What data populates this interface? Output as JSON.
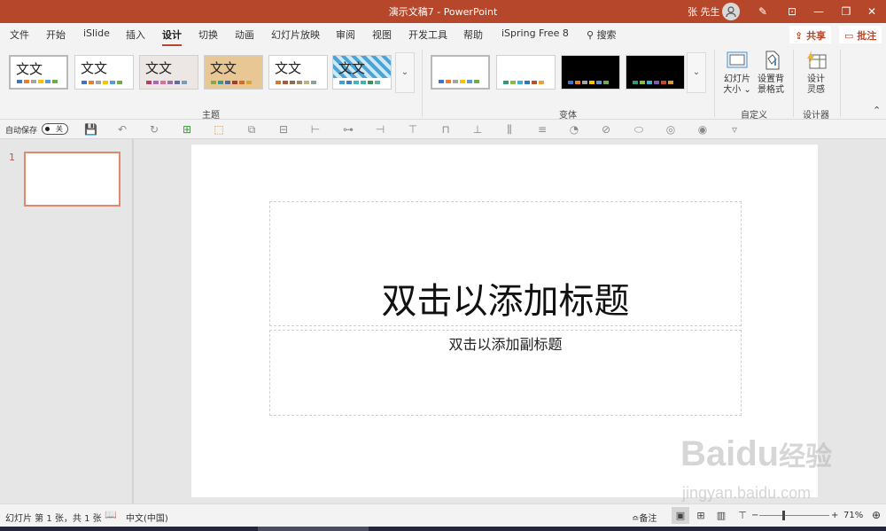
{
  "title_bar": {
    "document_title": "演示文稿7 - PowerPoint",
    "user_name": "张 先生",
    "icons": [
      "avatar-icon",
      "pen-icon",
      "ribbon-display-icon",
      "minimize-icon",
      "restore-icon",
      "close-icon"
    ],
    "glyphs": {
      "pen": "✎",
      "ribbon_display": "⊡",
      "minimize": "—",
      "restore": "❐",
      "close": "✕"
    }
  },
  "menu": {
    "tabs": [
      {
        "label": "文件"
      },
      {
        "label": "开始"
      },
      {
        "label": "iSlide"
      },
      {
        "label": "插入"
      },
      {
        "label": "设计",
        "active": true
      },
      {
        "label": "切换"
      },
      {
        "label": "动画"
      },
      {
        "label": "幻灯片放映"
      },
      {
        "label": "审阅"
      },
      {
        "label": "视图"
      },
      {
        "label": "开发工具"
      },
      {
        "label": "帮助"
      },
      {
        "label": "iSpring Free 8"
      }
    ],
    "search_label": "搜索",
    "search_glyph": "⚲",
    "share_label": "共享",
    "share_glyph": "⇪",
    "comment_label": "批注",
    "comment_glyph": "▭"
  },
  "ribbon": {
    "themes_group_label": "主题",
    "themes": [
      {
        "name": "office-theme",
        "text": "文文",
        "bg": "#ffffff",
        "swatches": [
          "#4472c4",
          "#ed7d31",
          "#a5a5a5",
          "#ffc000",
          "#5b9bd5",
          "#70ad47"
        ]
      },
      {
        "name": "office-theme-2",
        "text": "文文",
        "bg": "#ffffff",
        "swatches": [
          "#4472c4",
          "#ed7d31",
          "#a5a5a5",
          "#ffc000",
          "#5b9bd5",
          "#70ad47"
        ]
      },
      {
        "name": "theme-3",
        "text": "文文",
        "bg": "#ece7e4",
        "swatches": [
          "#b83d68",
          "#ac66bb",
          "#de6c9f",
          "#9d6fa6",
          "#5f6ca8",
          "#7b9bb7"
        ]
      },
      {
        "name": "theme-4",
        "text": "文文",
        "bg": "#e8c795",
        "swatches": [
          "#8da54b",
          "#3a9a8e",
          "#4c6aa6",
          "#a23c34",
          "#d46a2b",
          "#d3a43c"
        ]
      },
      {
        "name": "theme-5",
        "text": "文文",
        "bg": "#ffffff",
        "swatches": [
          "#d87b31",
          "#b0573a",
          "#8c6c4a",
          "#9d8b6a",
          "#bdb58a",
          "#8aa2a2"
        ]
      },
      {
        "name": "theme-6",
        "text": "文文",
        "bg": "#4da6d6",
        "swatches": [
          "#3aa0dd",
          "#3b7fc4",
          "#41b7c4",
          "#45b39f",
          "#3c8f5c",
          "#6ab0a4"
        ]
      }
    ],
    "variants_group_label": "变体",
    "variants": [
      {
        "bg": "#ffffff",
        "swatches": [
          "#4472c4",
          "#ed7d31",
          "#a5a5a5",
          "#ffc000",
          "#5b9bd5",
          "#70ad47"
        ]
      },
      {
        "bg": "#ffffff",
        "swatches": [
          "#2e9a7a",
          "#86bb45",
          "#3cb2cf",
          "#2f77b6",
          "#b4532a",
          "#f0a030"
        ]
      },
      {
        "bg": "#000000",
        "swatches": [
          "#4472c4",
          "#ed7d31",
          "#a5a5a5",
          "#ffc000",
          "#5b9bd5",
          "#70ad47"
        ]
      },
      {
        "bg": "#000000",
        "swatches": [
          "#2e9a7a",
          "#86bb45",
          "#3cb2cf",
          "#7e5bb0",
          "#c8482c",
          "#d99a36"
        ]
      }
    ],
    "more_glyph": "⌄",
    "customize_group_label": "自定义",
    "slide_size_label_1": "幻灯片",
    "slide_size_label_2": "大小 ⌄",
    "format_bg_label_1": "设置背",
    "format_bg_label_2": "景格式",
    "designer_group_label": "设计器",
    "design_ideas_label_1": "设计",
    "design_ideas_label_2": "灵感",
    "collapse_glyph": "⌃"
  },
  "qat": {
    "autosave_label": "自动保存",
    "autosave_state": "关",
    "icons": [
      {
        "name": "save-icon",
        "glyph": "💾"
      },
      {
        "name": "undo-icon",
        "glyph": "↶"
      },
      {
        "name": "redo-icon",
        "glyph": "↻"
      },
      {
        "name": "islide-align-icon",
        "glyph": "⊞"
      },
      {
        "name": "select-icon",
        "glyph": "⬚"
      },
      {
        "name": "group-icon",
        "glyph": "⧉"
      },
      {
        "name": "ungroup-icon",
        "glyph": "⊟"
      },
      {
        "name": "align-left-icon",
        "glyph": "⊢"
      },
      {
        "name": "align-center-icon",
        "glyph": "⊶"
      },
      {
        "name": "align-right-icon",
        "glyph": "⊣"
      },
      {
        "name": "align-top-icon",
        "glyph": "⊤"
      },
      {
        "name": "align-middle-icon",
        "glyph": "⊓"
      },
      {
        "name": "align-bottom-icon",
        "glyph": "⊥"
      },
      {
        "name": "distribute-h-icon",
        "glyph": "⫼"
      },
      {
        "name": "distribute-v-icon",
        "glyph": "≡"
      },
      {
        "name": "union-icon",
        "glyph": "◔"
      },
      {
        "name": "combine-icon",
        "glyph": "⊘"
      },
      {
        "name": "fragment-icon",
        "glyph": "⬭"
      },
      {
        "name": "intersect-icon",
        "glyph": "◎"
      },
      {
        "name": "subtract-icon",
        "glyph": "◉"
      },
      {
        "name": "customize-qat-icon",
        "glyph": "▿"
      }
    ]
  },
  "slides_pane": {
    "slides": [
      {
        "number": "1"
      }
    ]
  },
  "slide": {
    "title_placeholder": "双击以添加标题",
    "subtitle_placeholder": "双击以添加副标题"
  },
  "status_bar": {
    "slide_info": "幻灯片 第 1 张，共 1 张",
    "spellcheck_glyph": "📖",
    "language": "中文(中国)",
    "notes_label": "备注",
    "notes_glyph": "≏",
    "view_glyphs": {
      "normal": "▣",
      "sorter": "⊞",
      "reading": "▥",
      "slideshow": "⊤"
    },
    "zoom_minus": "−",
    "zoom_plus": "+",
    "zoom_level": "71%",
    "zoom_fraction": 0.71,
    "fit_glyph": "⊕"
  },
  "watermark": {
    "brand": "Bai",
    "brand_paw": "du",
    "brand_cn": "经验",
    "url": "jingyan.baidu.com"
  },
  "accent": "#b7472a"
}
